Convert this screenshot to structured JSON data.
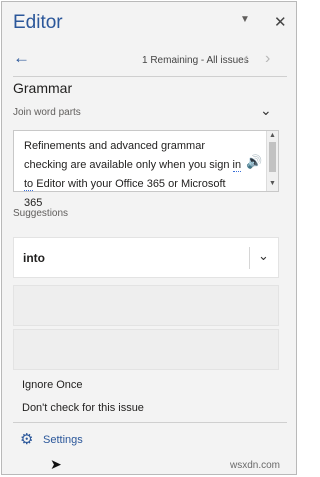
{
  "header": {
    "title": "Editor",
    "menu_icon": "caret-down-icon",
    "close_icon": "close-icon"
  },
  "nav": {
    "back_icon": "arrow-left-icon",
    "status": "1 Remaining - All issues",
    "prev_icon": "chevron-left-icon",
    "next_icon": "chevron-right-icon"
  },
  "issue": {
    "category": "Grammar",
    "section_label": "Join word parts",
    "message_before": "Refinements and advanced grammar checking are available only when you sign ",
    "message_flagged": "in to",
    "message_after": " Editor with your Office 365 or Microsoft 365",
    "speaker_icon": "speaker-icon"
  },
  "suggestions": {
    "label": "Suggestions",
    "items": [
      "into",
      "",
      ""
    ]
  },
  "actions": {
    "ignore": "Ignore Once",
    "dont_check": "Don't check for this issue"
  },
  "footer": {
    "settings_label": "Settings",
    "settings_icon": "gear-icon"
  },
  "watermark": "wsxdn.com",
  "colors": {
    "accent": "#2b579a",
    "pane_bg": "#f3f3f3",
    "text": "#201f1e"
  }
}
